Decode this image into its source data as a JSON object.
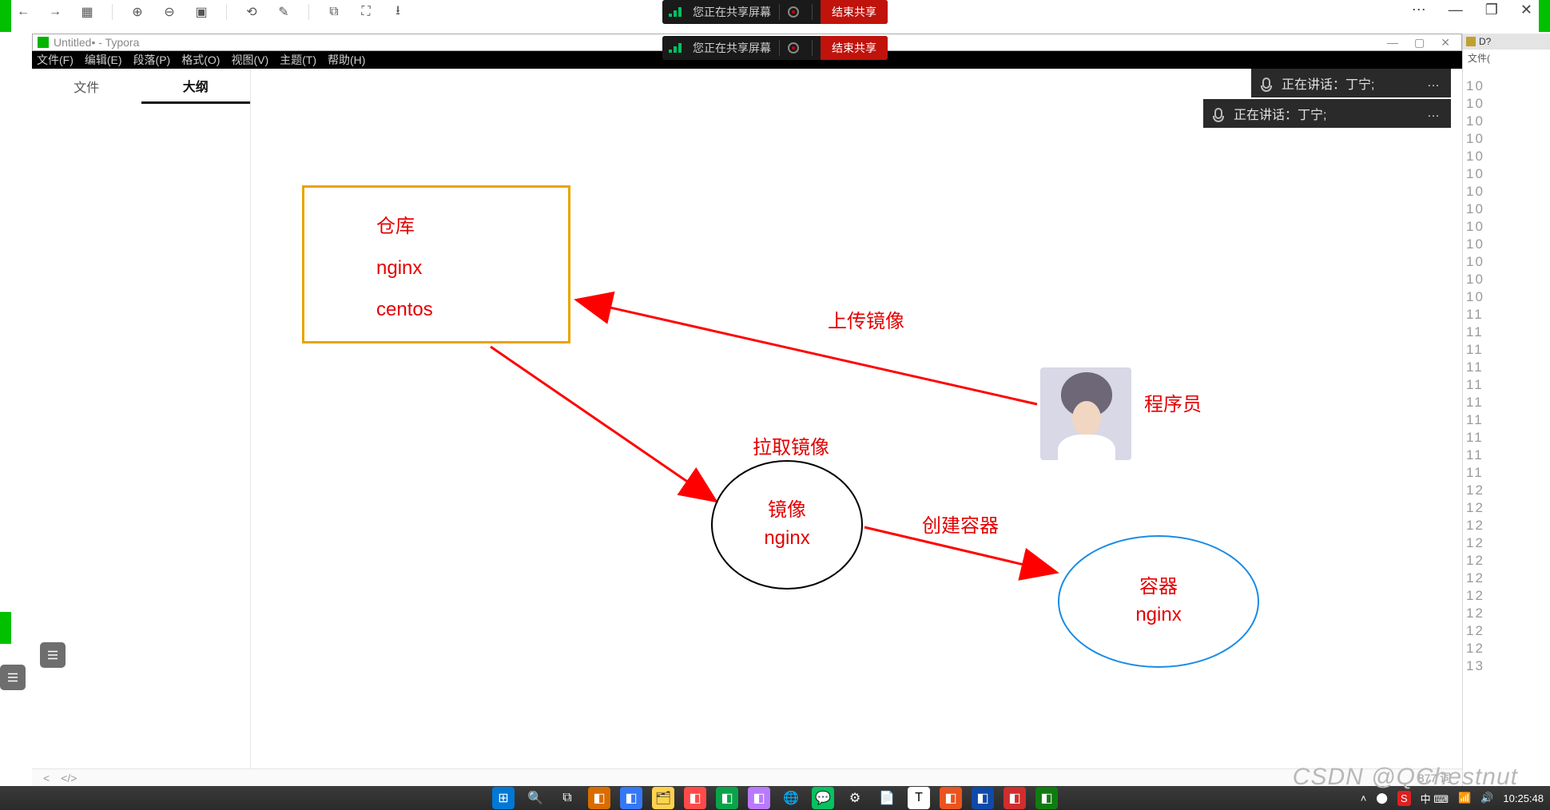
{
  "share": {
    "text": "您正在共享屏幕",
    "stop": "结束共享"
  },
  "typora": {
    "title": "Untitled• - Typora",
    "menus": [
      "文件(F)",
      "编辑(E)",
      "段落(P)",
      "格式(O)",
      "视图(V)",
      "主题(T)",
      "帮助(H)"
    ],
    "sidebar_tabs": {
      "file": "文件",
      "outline": "大纲"
    },
    "status": {
      "word_count": "877 词"
    }
  },
  "speaker": {
    "prefix": "正在讲话：",
    "name": "丁宁;"
  },
  "diagram": {
    "repo": {
      "title": "仓库",
      "items": [
        "nginx",
        "centos"
      ]
    },
    "image_node": {
      "line1": "镜像",
      "line2": "nginx"
    },
    "container_node": {
      "line1": "容器",
      "line2": "nginx"
    },
    "programmer_label": "程序员",
    "arrows": {
      "upload": "上传镜像",
      "pull": "拉取镜像",
      "create": "创建容器"
    }
  },
  "right_panel": {
    "badge": "D?",
    "label": "文件(",
    "lines": [
      "10",
      "10",
      "10",
      "10",
      "10",
      "10",
      "10",
      "10",
      "10",
      "10",
      "10",
      "10",
      "10",
      "11",
      "11",
      "11",
      "11",
      "11",
      "11",
      "11",
      "11",
      "11",
      "11",
      "12",
      "12",
      "12",
      "12",
      "12",
      "12",
      "12",
      "12",
      "12",
      "12",
      "13"
    ]
  },
  "tray": {
    "time": "10:25:48",
    "ime": "中 ⌨"
  },
  "watermark": "CSDN @QChestnut"
}
